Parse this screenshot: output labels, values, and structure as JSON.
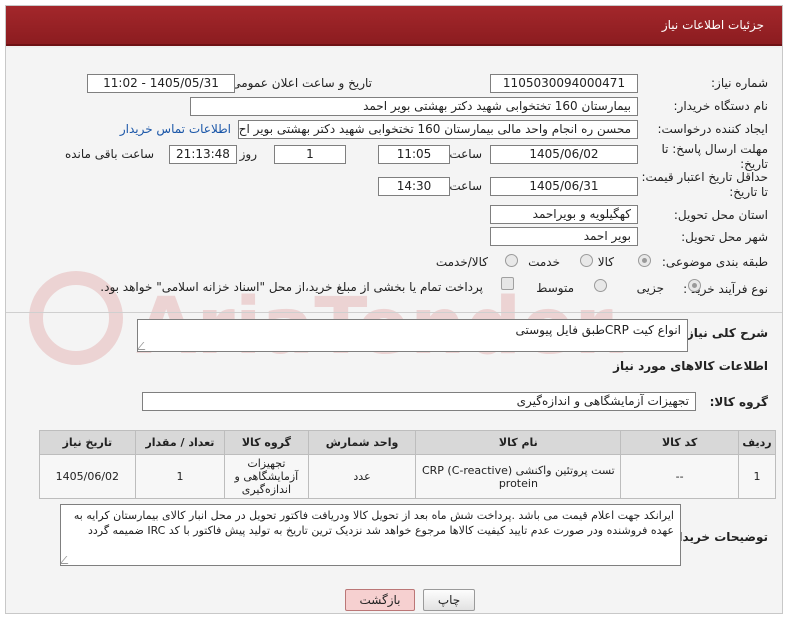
{
  "header": {
    "title": "جزئیات اطلاعات نیاز"
  },
  "fields": {
    "need_number": {
      "label": "شماره نیاز:",
      "value": "1105030094000471"
    },
    "announce_datetime": {
      "label": "تاریخ و ساعت اعلان عمومی:",
      "value": "1405/05/31 - 11:02"
    },
    "buyer_org": {
      "label": "نام دستگاه خریدار:",
      "value": "بیمارستان 160 تختخوابی شهید دکتر بهشتی بویر احمد"
    },
    "creator": {
      "label": "ایجاد کننده درخواست:",
      "value": "محسن ره انجام واحد مالی بیمارستان 160 تختخوابی شهید دکتر بهشتی بویر اح",
      "link": "اطلاعات تماس خریدار"
    },
    "deadline": {
      "label": "مهلت ارسال پاسخ: تا تاریخ:",
      "date": "1405/06/02",
      "time_label": "ساعت",
      "time": "11:05",
      "days": "1",
      "days_label": "روز و",
      "remaining": "21:13:48",
      "remaining_label": "ساعت باقی مانده"
    },
    "validity": {
      "label": "حداقل تاریخ اعتبار قیمت: تا تاریخ:",
      "date": "1405/06/31",
      "time_label": "ساعت",
      "time": "14:30"
    },
    "province": {
      "label": "استان محل تحویل:",
      "value": "کهگیلویه و بویراحمد"
    },
    "city": {
      "label": "شهر محل تحویل:",
      "value": "بویر احمد"
    },
    "category": {
      "label": "طبقه بندی موضوعی:",
      "options": [
        "کالا",
        "خدمت",
        "کالا/خدمت"
      ],
      "selected": "کالا"
    },
    "process": {
      "label": "نوع فرآیند خرید :",
      "options": [
        "جزیی",
        "متوسط"
      ],
      "selected": "جزیی",
      "treasury_note": "پرداخت تمام یا بخشی از مبلغ خرید،از محل \"اسناد خزانه اسلامی\" خواهد بود."
    }
  },
  "summary": {
    "label": "شرح کلی نیاز:",
    "value": "انواع کیت  CRPطبق فایل پیوستی"
  },
  "goods_section": {
    "title": "اطلاعات کالاهای مورد نیاز"
  },
  "goods_group": {
    "label": "گروه کالا:",
    "value": "تجهیزات آزمایشگاهی و اندازه‌گیری"
  },
  "table": {
    "headers": [
      "ردیف",
      "کد کالا",
      "نام کالا",
      "واحد شمارش",
      "گروه کالا",
      "تعداد / مقدار",
      "تاریخ نیاز"
    ],
    "rows": [
      [
        "1",
        "--",
        "تست پروتئین واکنشی (CRP (C-reactive protein",
        "عدد",
        "تجهیزات آزمایشگاهی و اندازه‌گیری",
        "1",
        "1405/06/02"
      ]
    ]
  },
  "buyer_notes": {
    "label": "توضیحات خریدار:",
    "value": "ایرانکد جهت اعلام قیمت می باشد .پرداخت شش ماه بعد از تحویل کالا ودریافت فاکتور تحویل در محل انبار کالای بیمارستان کرایه به عهده فروشنده ودر صورت عدم تایید کیفیت کالاها مرجوع خواهد شد نزدیک ترین تاریخ به تولید پیش فاکتور با کد IRC ضمیمه گردد"
  },
  "buttons": {
    "print": "چاپ",
    "back": "بازگشت"
  },
  "watermark": {
    "text": "AriaTender.net"
  },
  "colors": {
    "header": "#a3272b",
    "link": "#1a56a8",
    "back_button_bg": "#f6d0d0"
  }
}
